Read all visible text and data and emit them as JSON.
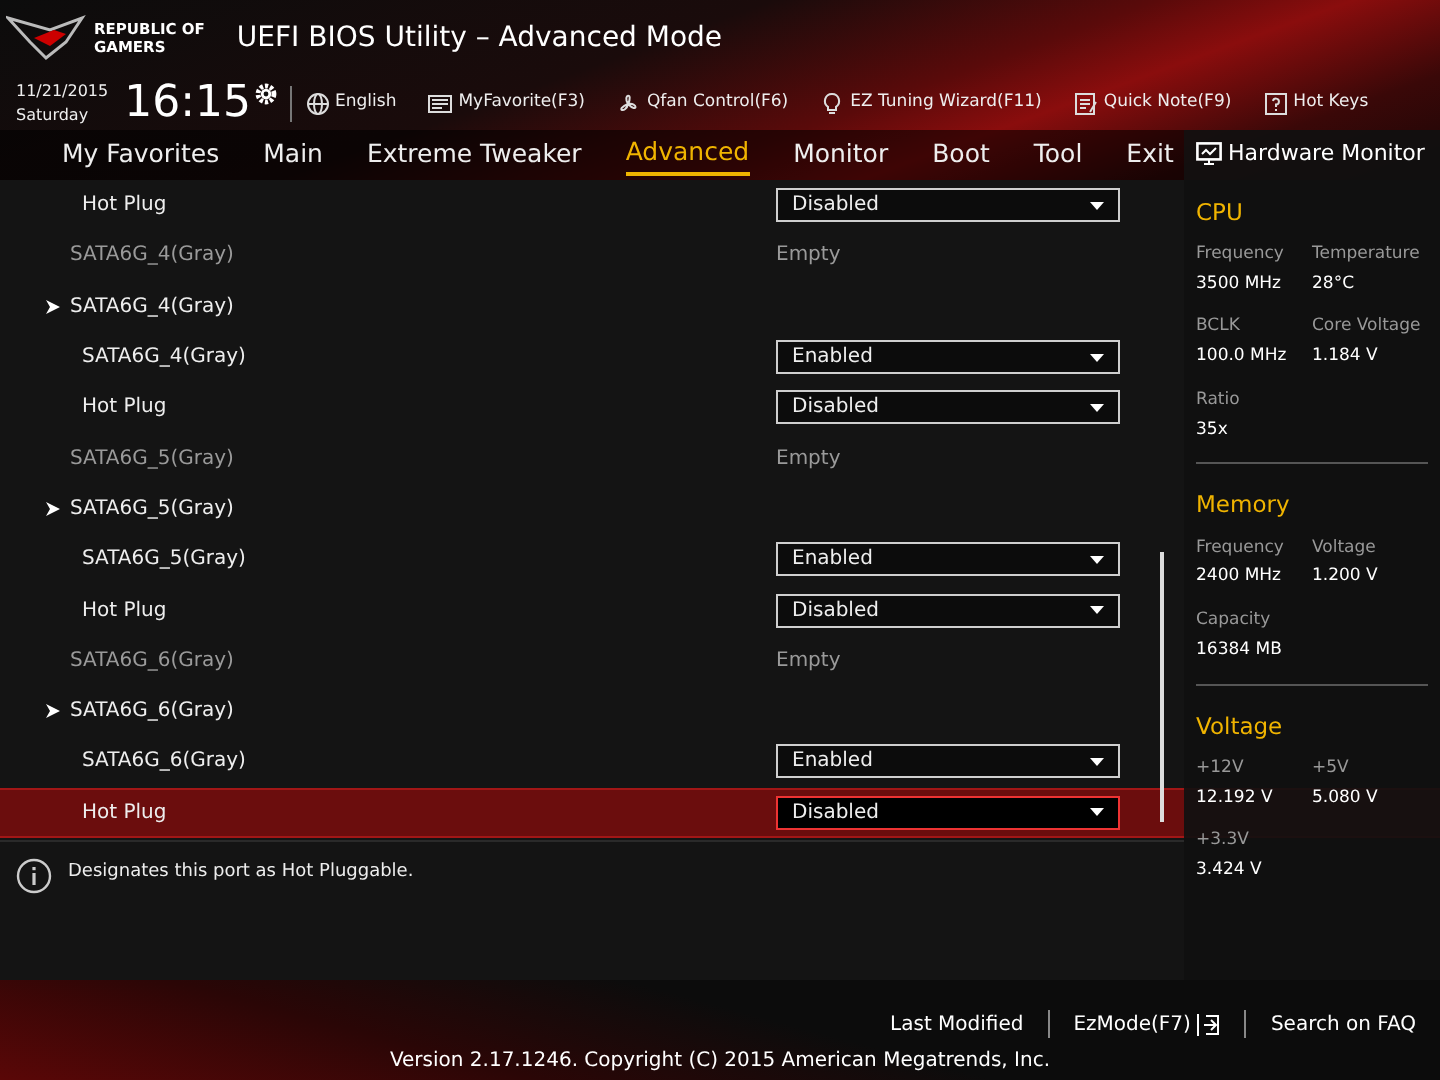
{
  "header": {
    "logo_line_1": "REPUBLIC OF",
    "logo_line_2": "GAMERS",
    "title": "UEFI BIOS Utility – Advanced Mode"
  },
  "toolbar": {
    "date": "11/21/2015",
    "day": "Saturday",
    "time": "16:15",
    "items": [
      "English",
      "MyFavorite(F3)",
      "Qfan Control(F6)",
      "EZ Tuning Wizard(F11)",
      "Quick Note(F9)",
      "Hot Keys"
    ]
  },
  "tabs": [
    {
      "label": "My Favorites",
      "selected": false
    },
    {
      "label": "Main",
      "selected": false
    },
    {
      "label": "Extreme Tweaker",
      "selected": false
    },
    {
      "label": "Advanced",
      "selected": true
    },
    {
      "label": "Monitor",
      "selected": false
    },
    {
      "label": "Boot",
      "selected": false
    },
    {
      "label": "Tool",
      "selected": false
    },
    {
      "label": "Exit",
      "selected": false
    }
  ],
  "rows": [
    {
      "kind": "setting",
      "label": "Hot Plug",
      "value": "Disabled",
      "selected": false
    },
    {
      "kind": "info",
      "label": "SATA6G_4(Gray)",
      "value": "Empty"
    },
    {
      "kind": "submenu",
      "label": "SATA6G_4(Gray)"
    },
    {
      "kind": "setting",
      "label": "SATA6G_4(Gray)",
      "value": "Enabled",
      "selected": false
    },
    {
      "kind": "setting",
      "label": "Hot Plug",
      "value": "Disabled",
      "selected": false
    },
    {
      "kind": "info",
      "label": "SATA6G_5(Gray)",
      "value": "Empty"
    },
    {
      "kind": "submenu",
      "label": "SATA6G_5(Gray)"
    },
    {
      "kind": "setting",
      "label": "SATA6G_5(Gray)",
      "value": "Enabled",
      "selected": false
    },
    {
      "kind": "setting",
      "label": "Hot Plug",
      "value": "Disabled",
      "selected": false
    },
    {
      "kind": "info",
      "label": "SATA6G_6(Gray)",
      "value": "Empty"
    },
    {
      "kind": "submenu",
      "label": "SATA6G_6(Gray)"
    },
    {
      "kind": "setting",
      "label": "SATA6G_6(Gray)",
      "value": "Enabled",
      "selected": false
    },
    {
      "kind": "setting",
      "label": "Hot Plug",
      "value": "Disabled",
      "selected": true
    }
  ],
  "help": "Designates this port as Hot Pluggable.",
  "hardware_monitor": {
    "title": "Hardware Monitor",
    "sections": [
      {
        "title": "CPU",
        "items": [
          {
            "label": "Frequency",
            "value": "3500 MHz"
          },
          {
            "label": "Temperature",
            "value": "28°C"
          },
          {
            "label": "BCLK",
            "value": "100.0 MHz"
          },
          {
            "label": "Core Voltage",
            "value": "1.184 V"
          },
          {
            "label": "Ratio",
            "value": "35x"
          }
        ]
      },
      {
        "title": "Memory",
        "items": [
          {
            "label": "Frequency",
            "value": "2400 MHz"
          },
          {
            "label": "Voltage",
            "value": "1.200 V"
          },
          {
            "label": "Capacity",
            "value": "16384 MB"
          }
        ]
      },
      {
        "title": "Voltage",
        "items": [
          {
            "label": "+12V",
            "value": "12.192 V"
          },
          {
            "label": "+5V",
            "value": "5.080 V"
          },
          {
            "label": "+3.3V",
            "value": "3.424 V"
          }
        ]
      }
    ]
  },
  "footer": {
    "links": [
      "Last Modified",
      "EzMode(F7)",
      "Search on FAQ"
    ],
    "version": "Version 2.17.1246. Copyright (C) 2015 American Megatrends, Inc."
  }
}
